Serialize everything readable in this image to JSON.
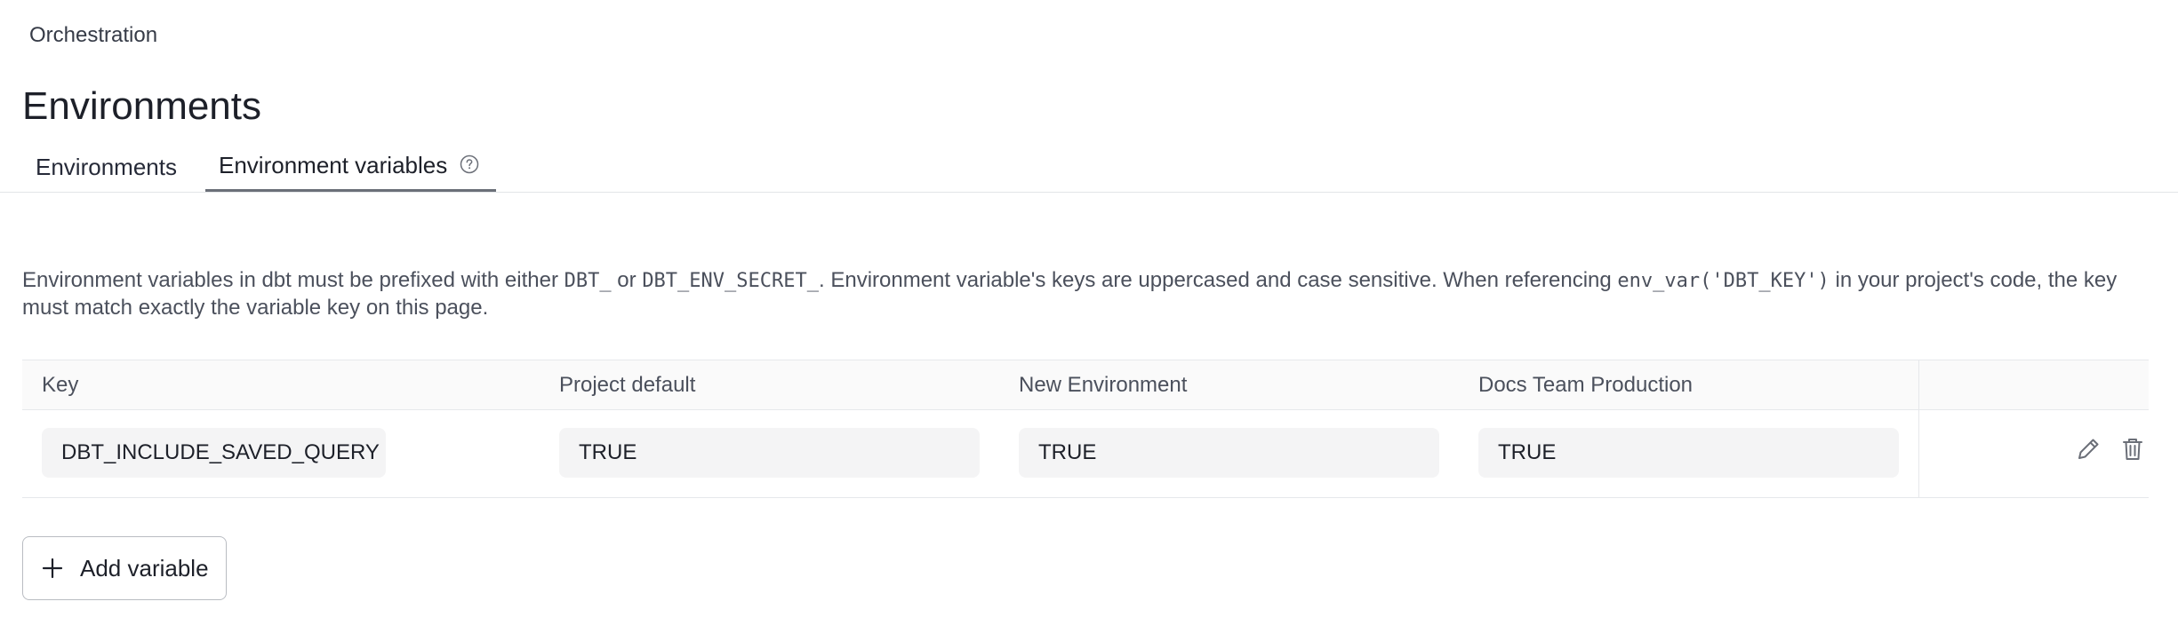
{
  "breadcrumb": {
    "label": "Orchestration"
  },
  "page": {
    "title": "Environments"
  },
  "tabs": [
    {
      "label": "Environments",
      "active": false
    },
    {
      "label": "Environment variables",
      "active": true,
      "icon": "help-circle-icon"
    }
  ],
  "description": {
    "part1": "Environment variables in dbt must be prefixed with either ",
    "code1": "DBT_",
    "part2": " or ",
    "code2": "DBT_ENV_SECRET_",
    "part3": ". Environment variable's keys are uppercased and case sensitive. When referencing ",
    "code3": "env_var('DBT_KEY')",
    "part4": " in your project's code, the key must match exactly the variable key on this page."
  },
  "table": {
    "columns": [
      "Key",
      "Project default",
      "New Environment",
      "Docs Team Production"
    ],
    "rows": [
      {
        "key": "DBT_INCLUDE_SAVED_QUERY",
        "values": [
          "TRUE",
          "TRUE",
          "TRUE"
        ],
        "actions": [
          "edit-pencil-icon",
          "delete-trash-icon"
        ]
      }
    ]
  },
  "add_button": {
    "label": "Add variable",
    "icon": "plus-icon"
  },
  "colors": {
    "text": "#262a38",
    "muted": "#4b505c",
    "border": "#e6e8eb",
    "cell_bg": "#f4f4f5",
    "tab_underline": "#6b6f78"
  }
}
